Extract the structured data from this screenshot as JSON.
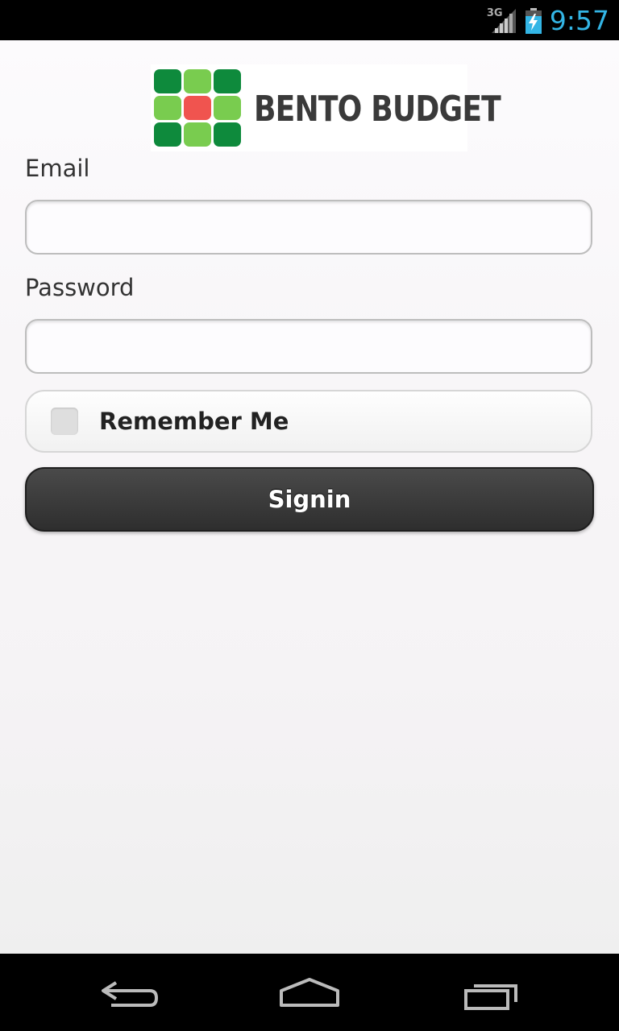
{
  "status_bar": {
    "network": "3G",
    "time": "9:57",
    "clock_color": "#33b5e5"
  },
  "logo": {
    "text": "BENTO BUDGET",
    "colors": {
      "dark_green": "#0e8a3c",
      "light_green": "#79cc4f",
      "red": "#f0544f"
    }
  },
  "form": {
    "email_label": "Email",
    "email_value": "",
    "password_label": "Password",
    "password_value": "",
    "remember_label": "Remember Me",
    "remember_checked": false,
    "signin_label": "Signin"
  },
  "nav": {
    "back_icon": "back-icon",
    "home_icon": "home-icon",
    "recents_icon": "recent-apps-icon"
  }
}
